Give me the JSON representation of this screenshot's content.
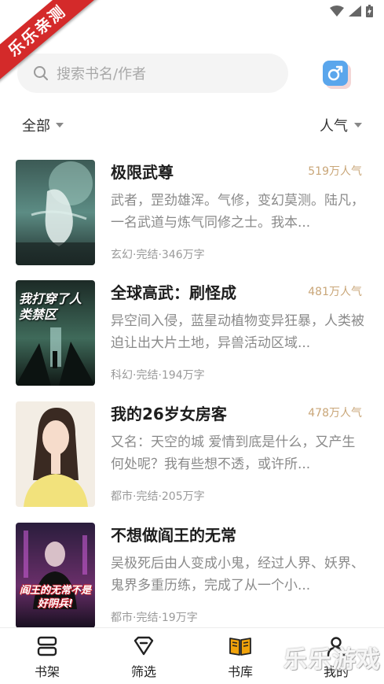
{
  "corner_badge": "乐乐亲测",
  "search": {
    "placeholder": "搜索书名/作者"
  },
  "filters": {
    "left_label": "全部",
    "right_label": "人气"
  },
  "books": [
    {
      "title": "极限武尊",
      "popularity": "519万人气",
      "desc": "武者，罡劲雄浑。气修，变幻莫测。陆凡，一名武道与炼气同修之士。我本...",
      "meta": "玄幻·完结·346万字"
    },
    {
      "title": "全球高武：刷怪成",
      "popularity": "481万人气",
      "desc": "异空间入侵，蓝星动植物变异狂暴，人类被迫让出大片土地，异兽活动区域...",
      "meta": "科幻·完结·194万字"
    },
    {
      "title": "我的26岁女房客",
      "popularity": "478万人气",
      "desc": "又名：天空的城 爱情到底是什么，又产生何处呢？我有些想不透，或许所...",
      "meta": "都市·完结·205万字"
    },
    {
      "title": "不想做阎王的无常",
      "popularity": "",
      "desc": "吴极死后由人变成小鬼，经过人界、妖界、鬼界多重历练，完成了从一个小...",
      "meta": "都市·完结·19万字"
    }
  ],
  "covers": [
    {
      "art_text": ""
    },
    {
      "art_text": "我打穿了人类禁区"
    },
    {
      "art_text": ""
    },
    {
      "art_text": "阎王的无常不是好阴兵!"
    }
  ],
  "nav": [
    {
      "label": "书架",
      "icon": "bookshelf-icon"
    },
    {
      "label": "筛选",
      "icon": "filter-icon"
    },
    {
      "label": "书库",
      "icon": "library-icon",
      "active": true
    },
    {
      "label": "我的",
      "icon": "profile-icon"
    }
  ],
  "watermark": "乐乐游戏",
  "colors": {
    "popularity": "#c9a678",
    "active_nav": "#f0a20a",
    "gender_button": "#5aa6ec",
    "badge": "#d42a2a"
  }
}
